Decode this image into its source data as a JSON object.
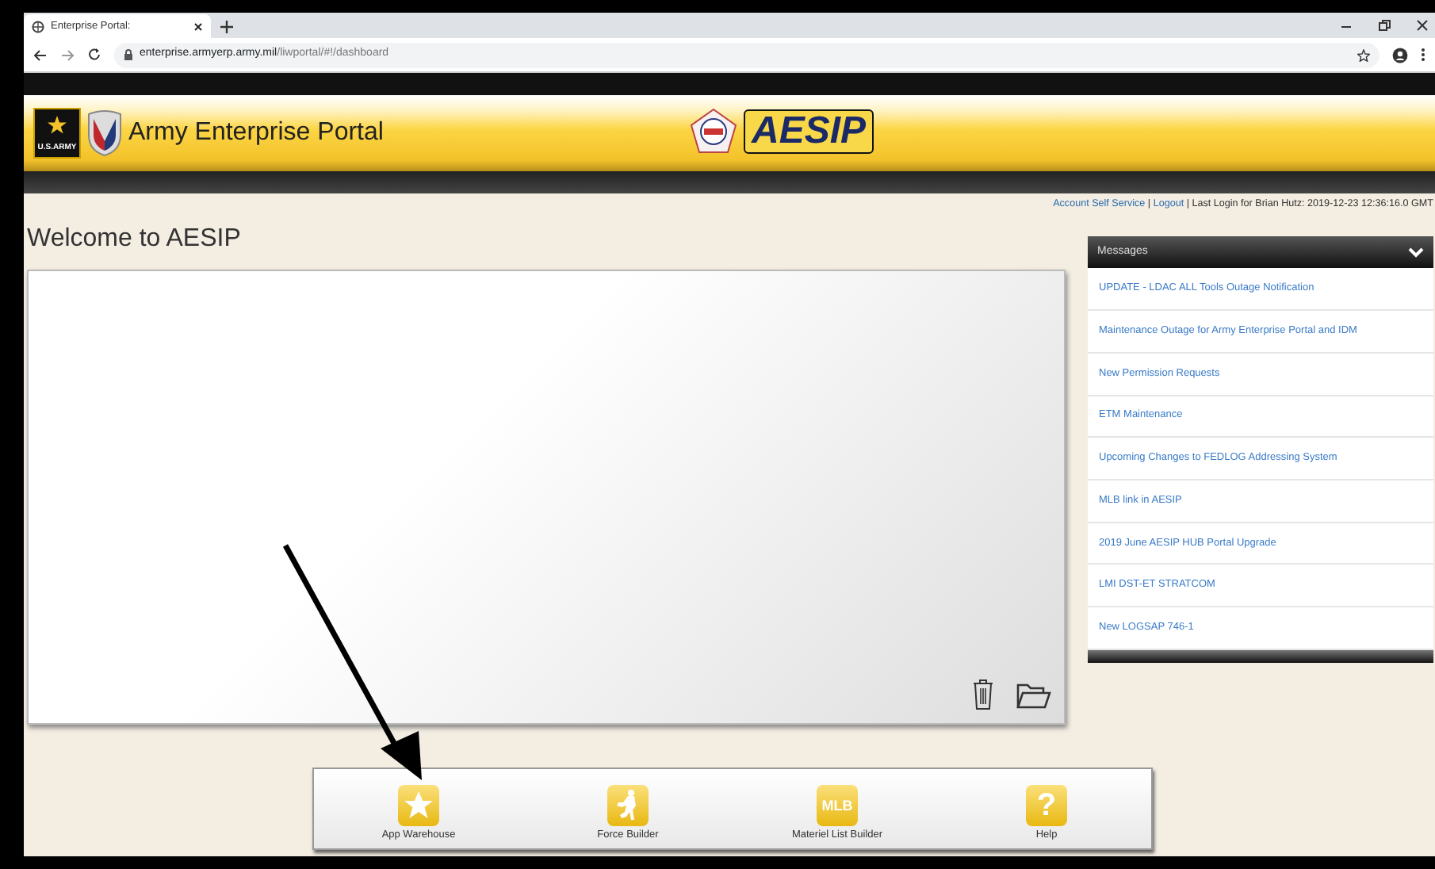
{
  "browser": {
    "tab_title": "Enterprise Portal:",
    "url_host": "enterprise.armyerp.army.mil",
    "url_path": "/liwportal/#!/dashboard"
  },
  "header": {
    "army_badge": "U.S.ARMY",
    "title": "Army Enterprise Portal",
    "logo_text": "AESIP"
  },
  "account_bar": {
    "links": [
      "Account Self Service",
      "Logout"
    ],
    "separator": "|",
    "last_login": "Last Login for Brian Hutz: 2019-12-23 12:36:16.0 GMT"
  },
  "welcome_title": "Welcome to AESIP",
  "messages": {
    "title": "Messages",
    "expanded": true,
    "items": [
      {
        "text": "UPDATE - LDAC ALL Tools Outage Notification"
      },
      {
        "text": "Maintenance Outage for Army Enterprise Portal and IDM"
      },
      {
        "text": "New Permission Requests"
      },
      {
        "text": "ETM Maintenance"
      },
      {
        "text": "Upcoming Changes to FEDLOG Addressing System"
      },
      {
        "text": "MLB link in AESIP"
      },
      {
        "text": "2019 June AESIP HUB Portal Upgrade"
      },
      {
        "text": "LMI DST-ET STRATCOM"
      },
      {
        "text": "New LOGSAP 746-1"
      }
    ]
  },
  "dock": [
    {
      "label": "App Warehouse",
      "kind": "star"
    },
    {
      "label": "Force Builder",
      "kind": "soldiers"
    },
    {
      "label": "Materiel List Builder",
      "kind": "text",
      "icon_text": "MLB"
    },
    {
      "label": "Help",
      "kind": "text",
      "icon_text": "?"
    }
  ]
}
